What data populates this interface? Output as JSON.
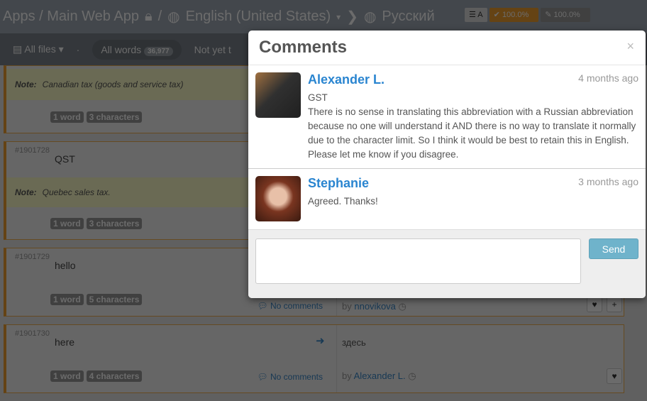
{
  "topbar": {
    "breadcrumb": "Apps / Main Web App",
    "lock_icon": "lock-icon",
    "separator": "/",
    "source_lang": "English (United States)",
    "target_lang": "Русский",
    "progress_translated": "100.0%",
    "progress_approved": "100.0%"
  },
  "toolbar": {
    "files": "All files",
    "all_words": "All words",
    "all_words_count": "36,977",
    "not_yet": "Not yet t"
  },
  "rows": [
    {
      "note_label": "Note:",
      "note": "Canadian tax (goods and service tax)",
      "words": "1 word",
      "chars": "3 characters"
    },
    {
      "id": "#1901728",
      "source": "QST",
      "note_label": "Note:",
      "note": "Quebec sales tax.",
      "words": "1 word",
      "chars": "3 characters"
    },
    {
      "id": "#1901729",
      "source": "hello",
      "words": "1 word",
      "chars": "5 characters",
      "comments": "No comments",
      "by": "by",
      "author": "nnovikova"
    },
    {
      "id": "#1901730",
      "source": "here",
      "translation": "здесь",
      "words": "1 word",
      "chars": "4 characters",
      "comments": "No comments",
      "by": "by",
      "author": "Alexander L."
    }
  ],
  "modal": {
    "title": "Comments",
    "close": "×",
    "send": "Send",
    "textarea_value": "",
    "comments": [
      {
        "name": "Alexander L.",
        "time": "4 months ago",
        "text": "GST\nThere is no sense in translating this abbreviation with a Russian abbreviation because no one will understand it AND there is no way to translate it normally due to the character limit. So I think it would be best to retain this in English. Please let me know if you disagree."
      },
      {
        "name": "Stephanie",
        "time": "3 months ago",
        "text": "Agreed. Thanks!"
      }
    ]
  },
  "colors": {
    "accent": "#2a85d0",
    "row_border": "#f0a030",
    "send": "#6fb3cb"
  }
}
